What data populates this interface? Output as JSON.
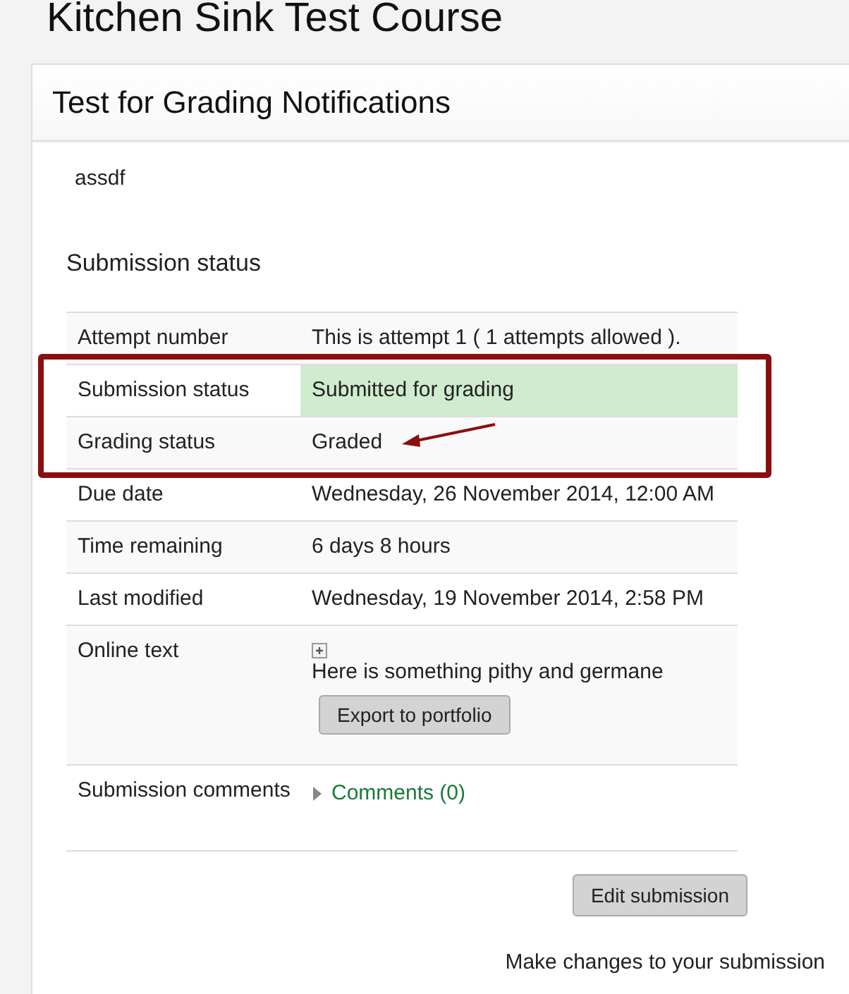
{
  "course_title": "Kitchen Sink Test Course",
  "card": {
    "title": "Test for Grading Notifications",
    "description": "assdf",
    "section_heading": "Submission status",
    "row_groups": [
      {
        "framed": false,
        "rows": [
          {
            "kind": "text",
            "label": "Attempt number",
            "value": "This is attempt 1 ( 1 attempts allowed ).",
            "highlight": false
          }
        ]
      },
      {
        "framed": true,
        "rows": [
          {
            "kind": "text",
            "label": "Submission status",
            "value": "Submitted for grading",
            "highlight": true
          },
          {
            "kind": "text",
            "label": "Grading status",
            "value": "Graded",
            "highlight": false,
            "arrow": true
          }
        ]
      },
      {
        "framed": false,
        "rows": [
          {
            "kind": "text",
            "label": "Due date",
            "value": "Wednesday, 26 November 2014, 12:00 AM",
            "highlight": false
          },
          {
            "kind": "text",
            "label": "Time remaining",
            "value": "6 days 8 hours",
            "highlight": false
          },
          {
            "kind": "text",
            "label": "Last modified",
            "value": "Wednesday, 19 November 2014, 2:58 PM",
            "highlight": false
          },
          {
            "kind": "online_text",
            "label": "Online text",
            "value": "Here is something pithy and germane",
            "button": "Export to portfolio",
            "highlight": false
          },
          {
            "kind": "comments",
            "label": "Submission comments",
            "value": "Comments (0)",
            "expanded": false,
            "highlight": false
          }
        ]
      }
    ],
    "edit_button": "Edit submission",
    "edit_hint": "Make changes to your submission"
  }
}
